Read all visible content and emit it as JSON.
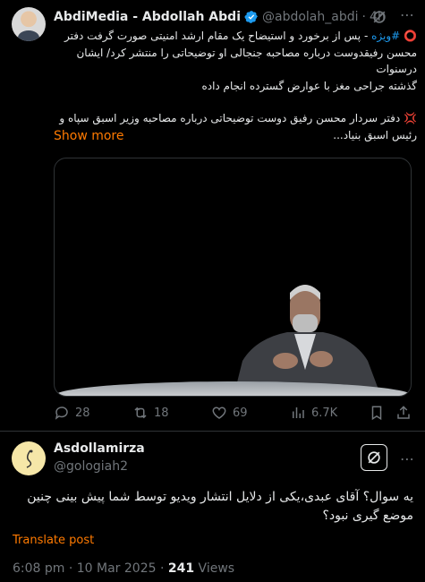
{
  "tweet1": {
    "name": "AbdiMedia - Abdollah Abdi",
    "handle": "@abdolah_abdi",
    "time": "4h",
    "line1_tag": "#ویژه",
    "line1_rest": " - پس از برخورد و استیضاح یک مقام ارشد امنیتی صورت گرفت دفتر",
    "line2": "محسن رفیقدوست درباره مصاحبه جنجالی او توضیحاتی را منتشر کرد/ ایشان درسنوات",
    "line3": "گذشته جراحی مغز با عوارض گسترده انجام داده",
    "line4": "دفتر سردار محسن رفیق دوست توضیحاتی درباره مصاحبه وزیر اسبق سپاه و",
    "line5": "رئیس اسبق بنیاد...",
    "show_more": "Show more",
    "stats": {
      "replies": "28",
      "reposts": "18",
      "likes": "69",
      "views": "6.7K"
    }
  },
  "tweet2": {
    "name": "Asdollamirza",
    "handle": "@gologiah2",
    "text": "یه سوال؟ آقای عبدی،یکی از دلایل انتشار ویدیو توسط شما پیش بینی چنین موضع گیری نبود؟",
    "translate": "Translate post",
    "timestamp": "6:08 pm · 10 Mar 2025 · ",
    "views_count": "241",
    "views_label": " Views"
  },
  "icons": [
    "verified-badge-icon",
    "grok-icon",
    "more-icon",
    "reply-icon",
    "repost-icon",
    "like-icon",
    "views-icon",
    "bookmark-icon",
    "share-icon"
  ],
  "colors": {
    "accent": "#ff7a00",
    "hashtag": "#1d9bf0",
    "verified": "#1d9bf0",
    "muted": "#71767b",
    "red": "#f4212e"
  }
}
